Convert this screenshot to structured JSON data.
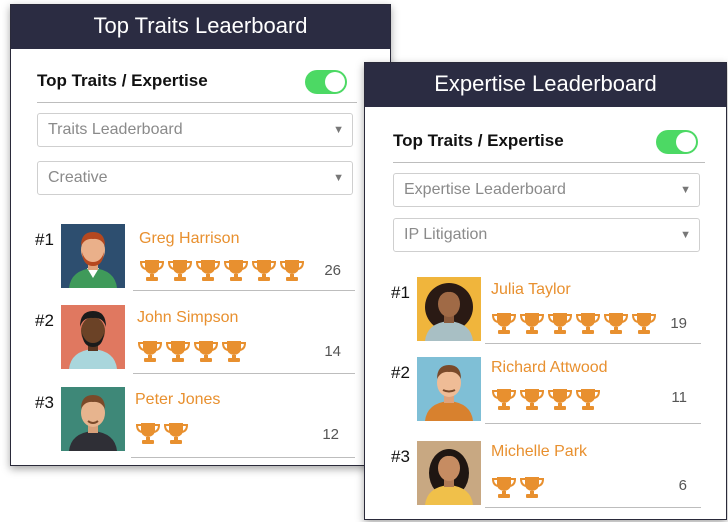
{
  "panels": [
    {
      "title": "Top Traits Leaerboard",
      "toggle_label": "Top Traits / Expertise",
      "toggle_on": true,
      "select_primary": "Traits Leaderboard",
      "select_secondary": "Creative",
      "entries": [
        {
          "rank": "#1",
          "name": "Greg Harrison",
          "trophies": 6,
          "score": "26",
          "avatar_bg": "#2d4e6f"
        },
        {
          "rank": "#2",
          "name": "John Simpson",
          "trophies": 4,
          "score": "14",
          "avatar_bg": "#e07860"
        },
        {
          "rank": "#3",
          "name": "Peter Jones",
          "trophies": 2,
          "score": "12",
          "avatar_bg": "#3e8878"
        }
      ]
    },
    {
      "title": "Expertise Leaderboard",
      "toggle_label": "Top Traits / Expertise",
      "toggle_on": true,
      "select_primary": "Expertise Leaderboard",
      "select_secondary": "IP Litigation",
      "entries": [
        {
          "rank": "#1",
          "name": "Julia Taylor",
          "trophies": 6,
          "score": "19",
          "avatar_bg": "#f0b53c"
        },
        {
          "rank": "#2",
          "name": "Richard Attwood",
          "trophies": 4,
          "score": "11",
          "avatar_bg": "#7fbfd6"
        },
        {
          "rank": "#3",
          "name": "Michelle Park",
          "trophies": 2,
          "score": "6",
          "avatar_bg": "#c8a882"
        }
      ]
    }
  ],
  "icons": {
    "trophy": "trophy-icon",
    "chevron": "chevron-down-icon"
  },
  "colors": {
    "header_bg": "#2b2c42",
    "accent_orange": "#e8902f",
    "toggle_green": "#4cd964"
  }
}
